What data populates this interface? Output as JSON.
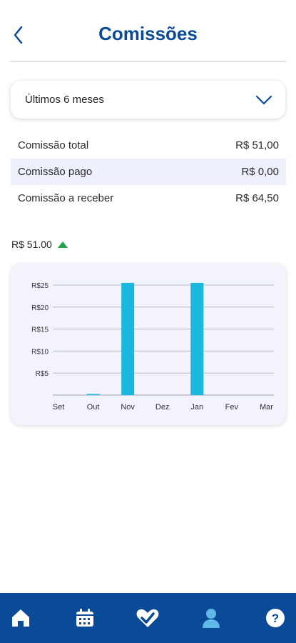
{
  "header": {
    "title": "Comissões"
  },
  "filter": {
    "selected": "Últimos 6 meses"
  },
  "summary": [
    {
      "label": "Comissão total",
      "value": "R$ 51,00"
    },
    {
      "label": "Comissão pago",
      "value": "R$ 0,00"
    },
    {
      "label": "Comissão a receber",
      "value": "R$ 64,50"
    }
  ],
  "total_indicator": {
    "value": "R$ 51.00",
    "trend": "up",
    "trend_color": "#1fa34a"
  },
  "chart_data": {
    "type": "bar",
    "categories": [
      "Set",
      "Out",
      "Nov",
      "Dez",
      "Jan",
      "Fev",
      "Mar"
    ],
    "values": [
      0,
      0.2,
      25.5,
      0,
      25.5,
      0,
      0
    ],
    "ylim": [
      0,
      25
    ],
    "yticks": [
      "R$5",
      "R$10",
      "R$15",
      "R$20",
      "R$25"
    ],
    "bar_color": "#1ab8de",
    "grid": true
  },
  "nav": {
    "items": [
      {
        "icon": "home-icon"
      },
      {
        "icon": "calendar-icon"
      },
      {
        "icon": "heart-icon"
      },
      {
        "icon": "user-icon",
        "active": true
      },
      {
        "icon": "help-icon"
      }
    ],
    "accent": "#0b4a97",
    "active_color": "#5fb8e8"
  }
}
